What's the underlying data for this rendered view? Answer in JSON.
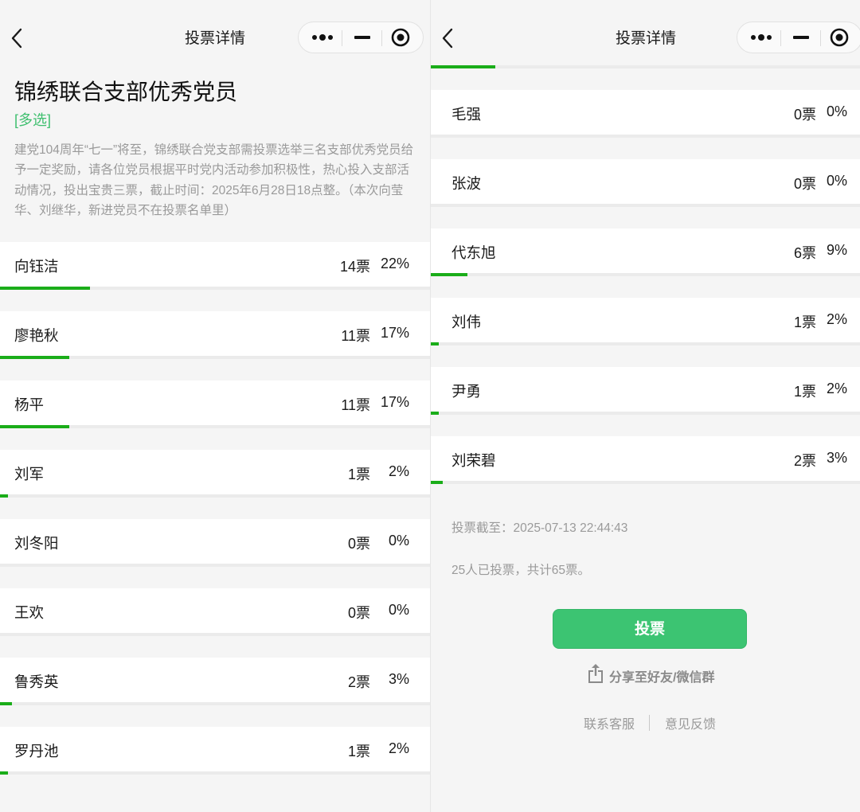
{
  "navbar": {
    "title": "投票详情"
  },
  "vote": {
    "title": "锦绣联合支部优秀党员",
    "type_label": "[多选]",
    "description": "建党104周年“七一”将至，锦绣联合党支部需投票选举三名支部优秀党员给予一定奖励，请各位党员根据平时党内活动参加积极性，热心投入支部活动情况，投出宝贵三票，截止时间：2025年6月28日18点整。（本次向莹华、刘继华，新进党员不在投票名单里）"
  },
  "options_left": [
    {
      "name": "向钰洁",
      "votes": "14票",
      "percent": "22%",
      "fraction": 0.22
    },
    {
      "name": "廖艳秋",
      "votes": "11票",
      "percent": "17%",
      "fraction": 0.17
    },
    {
      "name": "杨平",
      "votes": "11票",
      "percent": "17%",
      "fraction": 0.17
    },
    {
      "name": "刘军",
      "votes": "1票",
      "percent": "2%",
      "fraction": 0.02
    },
    {
      "name": "刘冬阳",
      "votes": "0票",
      "percent": "0%",
      "fraction": 0.0
    },
    {
      "name": "王欢",
      "votes": "0票",
      "percent": "0%",
      "fraction": 0.0
    },
    {
      "name": "鲁秀英",
      "votes": "2票",
      "percent": "3%",
      "fraction": 0.03
    },
    {
      "name": "罗丹池",
      "votes": "1票",
      "percent": "2%",
      "fraction": 0.02
    }
  ],
  "options_right": [
    {
      "name": "毛强",
      "votes": "0票",
      "percent": "0%",
      "fraction": 0.0
    },
    {
      "name": "张波",
      "votes": "0票",
      "percent": "0%",
      "fraction": 0.0
    },
    {
      "name": "代东旭",
      "votes": "6票",
      "percent": "9%",
      "fraction": 0.09
    },
    {
      "name": "刘伟",
      "votes": "1票",
      "percent": "2%",
      "fraction": 0.02
    },
    {
      "name": "尹勇",
      "votes": "1票",
      "percent": "2%",
      "fraction": 0.02
    },
    {
      "name": "刘荣碧",
      "votes": "2票",
      "percent": "3%",
      "fraction": 0.03
    }
  ],
  "meta": {
    "deadline": "投票截至：2025-07-13 22:44:43",
    "summary": "25人已投票，共计65票。"
  },
  "actions": {
    "vote_button": "投票",
    "share": "分享至好友/微信群",
    "contact": "联系客服",
    "feedback": "意见反馈"
  },
  "colors": {
    "accent": "#3cc472",
    "progress": "#1aad19",
    "type_label": "#3fbf6f"
  },
  "icons": [
    "back-arrow-icon",
    "more-icon",
    "minimize-icon",
    "close-target-icon",
    "share-icon"
  ]
}
